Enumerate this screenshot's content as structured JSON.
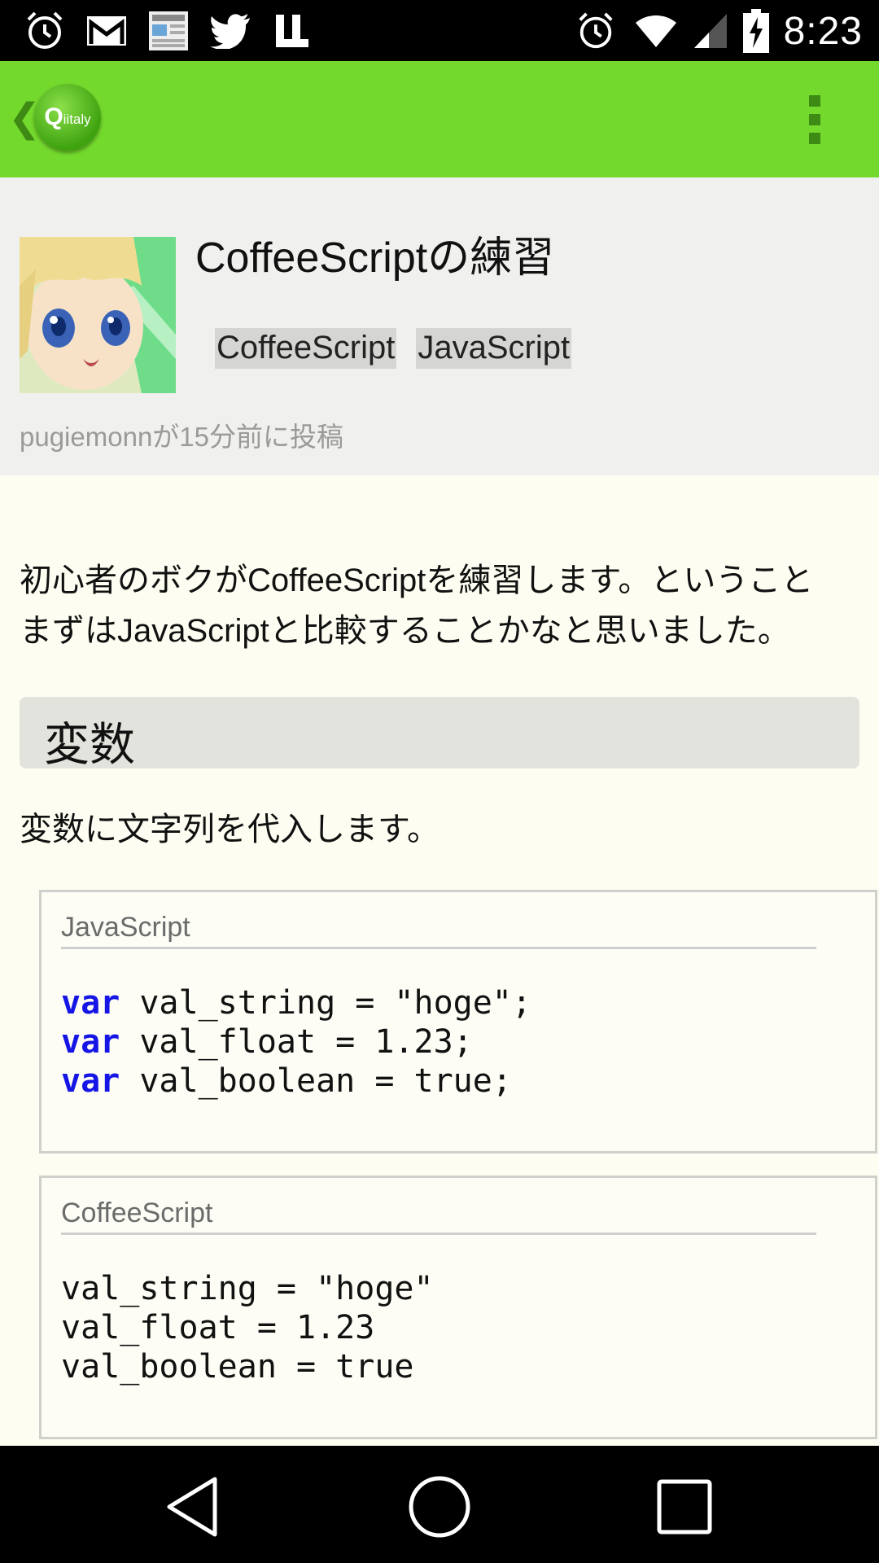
{
  "status_bar": {
    "time": "8:23",
    "left_icons": [
      "alarm-icon",
      "gmail-icon",
      "smartnews-icon",
      "twitter-icon",
      "launcher-icon"
    ],
    "right_icons": [
      "alarm-icon",
      "wifi-icon",
      "signal-icon",
      "battery-charging-icon"
    ]
  },
  "app_bar": {
    "logo_text_q": "Q",
    "logo_text_rest": "iitaly"
  },
  "post": {
    "title": "CoffeeScriptの練習",
    "tags": [
      "CoffeeScript",
      "JavaScript"
    ],
    "meta": "pugiemonnが15分前に投稿"
  },
  "content": {
    "intro_line1": "初心者のボクがCoffeeScriptを練習します。ということ",
    "intro_line2": "まずはJavaScriptと比較することかなと思いました。",
    "section_heading": "変数",
    "section_text": "変数に文字列を代入します。",
    "code_blocks": [
      {
        "lang": "JavaScript",
        "lines": [
          {
            "kw": "var",
            "rest": " val_string = \"hoge\";"
          },
          {
            "kw": "var",
            "rest": " val_float = 1.23;"
          },
          {
            "kw": "var",
            "rest": " val_boolean = true;"
          }
        ]
      },
      {
        "lang": "CoffeeScript",
        "lines": [
          {
            "kw": "",
            "rest": "val_string = \"hoge\""
          },
          {
            "kw": "",
            "rest": "val_float = 1.23"
          },
          {
            "kw": "",
            "rest": "val_boolean = true"
          }
        ]
      }
    ]
  },
  "nav_bar": {
    "buttons": [
      "back-icon",
      "home-icon",
      "recents-icon"
    ]
  },
  "colors": {
    "app_bar": "#74d92d",
    "keyword": "#1515e6",
    "page_bg": "#fdfdf1"
  }
}
